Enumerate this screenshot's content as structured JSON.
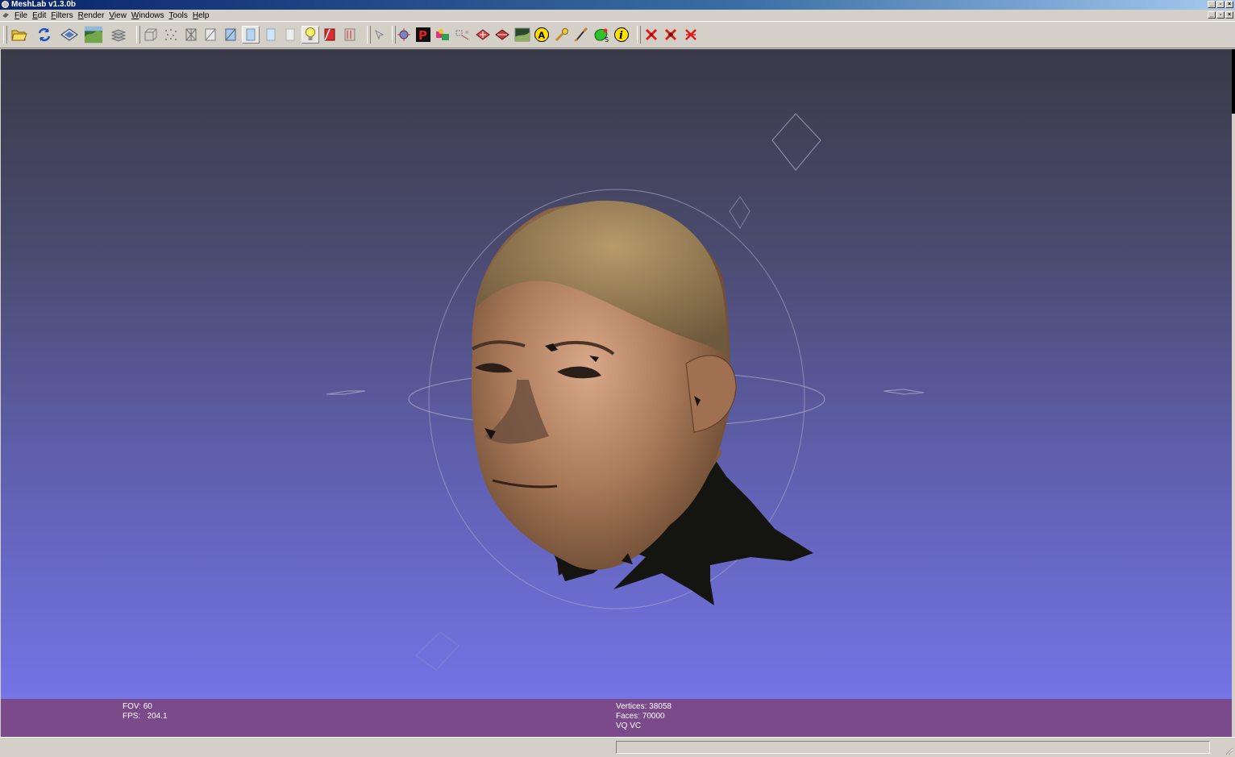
{
  "window": {
    "title": "MeshLab v1.3.0b",
    "controls": [
      "minimize",
      "restore",
      "close"
    ]
  },
  "menubar": {
    "items": [
      {
        "label": "File",
        "key": "F",
        "rest": "ile"
      },
      {
        "label": "Edit",
        "key": "E",
        "rest": "dit"
      },
      {
        "label": "Filters",
        "key": "F",
        "rest": "ilters"
      },
      {
        "label": "Render",
        "key": "R",
        "rest": "ender"
      },
      {
        "label": "View",
        "key": "V",
        "rest": "iew"
      },
      {
        "label": "Windows",
        "key": "W",
        "rest": "indows"
      },
      {
        "label": "Tools",
        "key": "T",
        "rest": "ools"
      },
      {
        "label": "Help",
        "key": "H",
        "rest": "elp"
      }
    ]
  },
  "toolbar": {
    "buttons": [
      "open-icon",
      "reload-icon",
      "save-icon",
      "snapshot-icon",
      "layers-icon",
      "bbox-icon",
      "points-icon",
      "wireframe-icon",
      "hiddenlines-icon",
      "flatlines-icon",
      "flat-icon",
      "smooth-icon",
      "texture-icon",
      "light-icon",
      "backface-icon",
      "color-mode-icon",
      "manipulator-icon",
      "info-picker-icon",
      "paint-p-icon",
      "align-icon",
      "select-vertices-icon",
      "select-faces-icon",
      "select-connected-icon",
      "raster-icon",
      "annotate-a-icon",
      "measure-icon",
      "paint-brush-icon",
      "sample-icon",
      "info-icon",
      "delete-vertices-icon",
      "delete-faces-icon",
      "delete-both-icon"
    ],
    "active_index": 13
  },
  "info": {
    "fov": "FOV: 60",
    "fps": "FPS:   204.1",
    "vertices": "Vertices: 38058",
    "faces": "Faces: 70000",
    "mode": "VQ VC"
  },
  "colors": {
    "title_start": "#0a246a",
    "title_end": "#a6caf0",
    "viewport_top": "#3a3a48",
    "viewport_bottom": "#7474e6",
    "info_band": "#7b4a8a",
    "chrome": "#d4d0c8"
  }
}
